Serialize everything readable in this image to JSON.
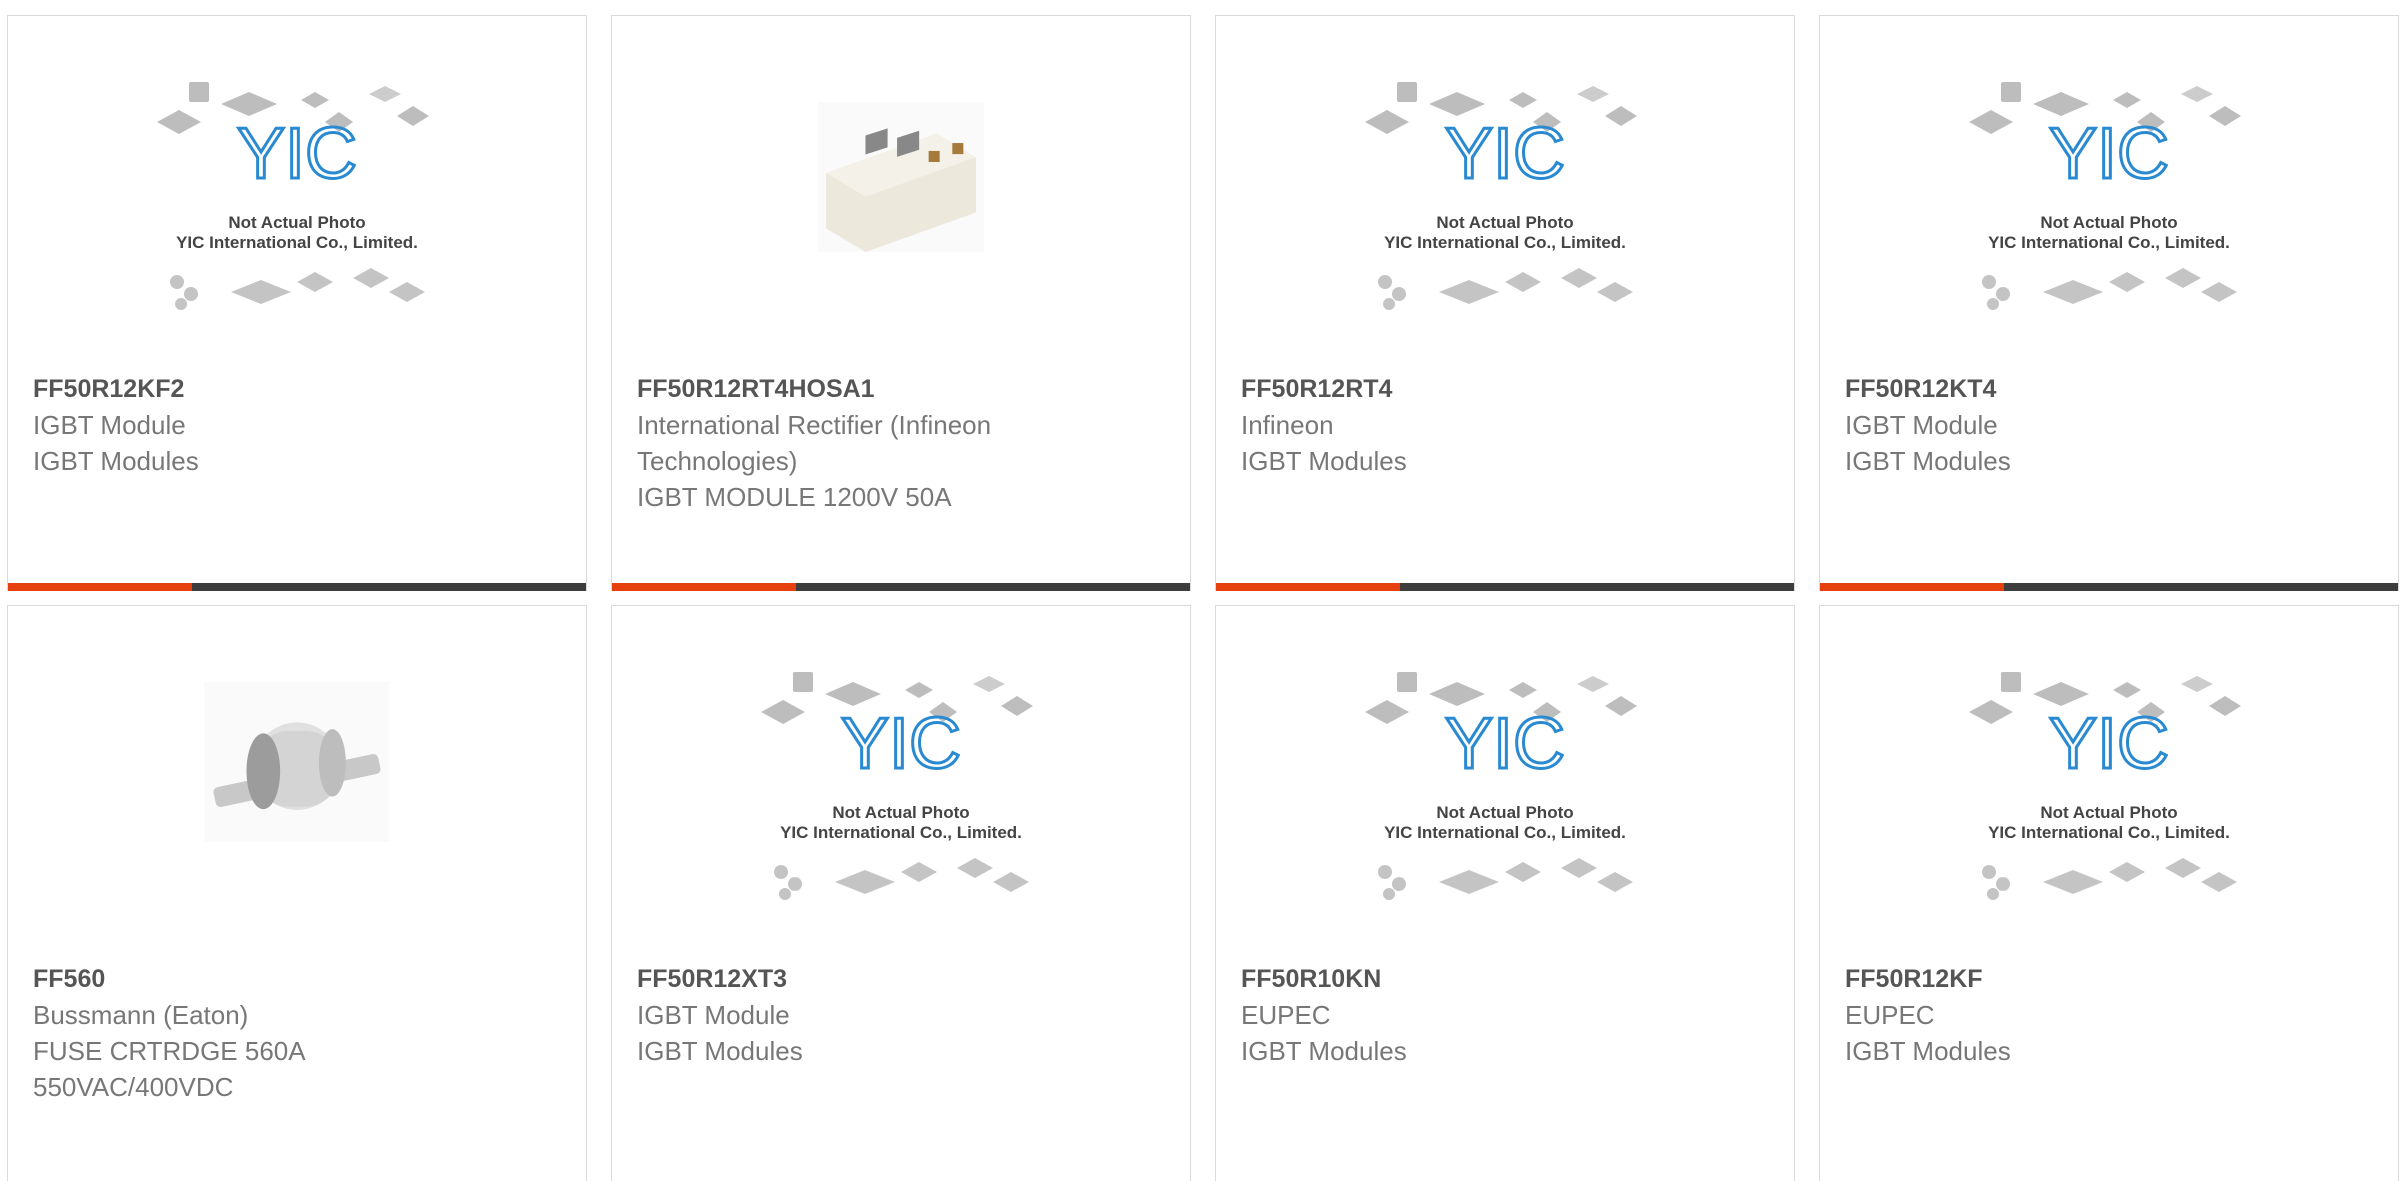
{
  "colors": {
    "accent": "#e6400f",
    "bar_dark": "#3d3d3d",
    "border": "#d9d9d9"
  },
  "placeholder": {
    "line1": "Not Actual Photo",
    "line2": "YIC International Co., Limited.",
    "logo": "YIC"
  },
  "products": [
    {
      "part": "FF50R12KF2",
      "lines": [
        "IGBT Module",
        "IGBT Modules"
      ],
      "image": "placeholder"
    },
    {
      "part": "FF50R12RT4HOSA1",
      "lines": [
        "International Rectifier (Infineon",
        "Technologies)",
        "IGBT MODULE 1200V 50A"
      ],
      "image": "igbt-module-photo"
    },
    {
      "part": "FF50R12RT4",
      "lines": [
        "Infineon",
        "IGBT Modules"
      ],
      "image": "placeholder"
    },
    {
      "part": "FF50R12KT4",
      "lines": [
        "IGBT Module",
        "IGBT Modules"
      ],
      "image": "placeholder"
    },
    {
      "part": "FF560",
      "lines": [
        "Bussmann (Eaton)",
        "FUSE CRTRDGE 560A",
        "550VAC/400VDC"
      ],
      "image": "fuse-photo"
    },
    {
      "part": "FF50R12XT3",
      "lines": [
        "IGBT Module",
        "IGBT Modules"
      ],
      "image": "placeholder"
    },
    {
      "part": "FF50R10KN",
      "lines": [
        "EUPEC",
        "IGBT Modules"
      ],
      "image": "placeholder"
    },
    {
      "part": "FF50R12KF",
      "lines": [
        "EUPEC",
        "IGBT Modules"
      ],
      "image": "placeholder"
    }
  ]
}
